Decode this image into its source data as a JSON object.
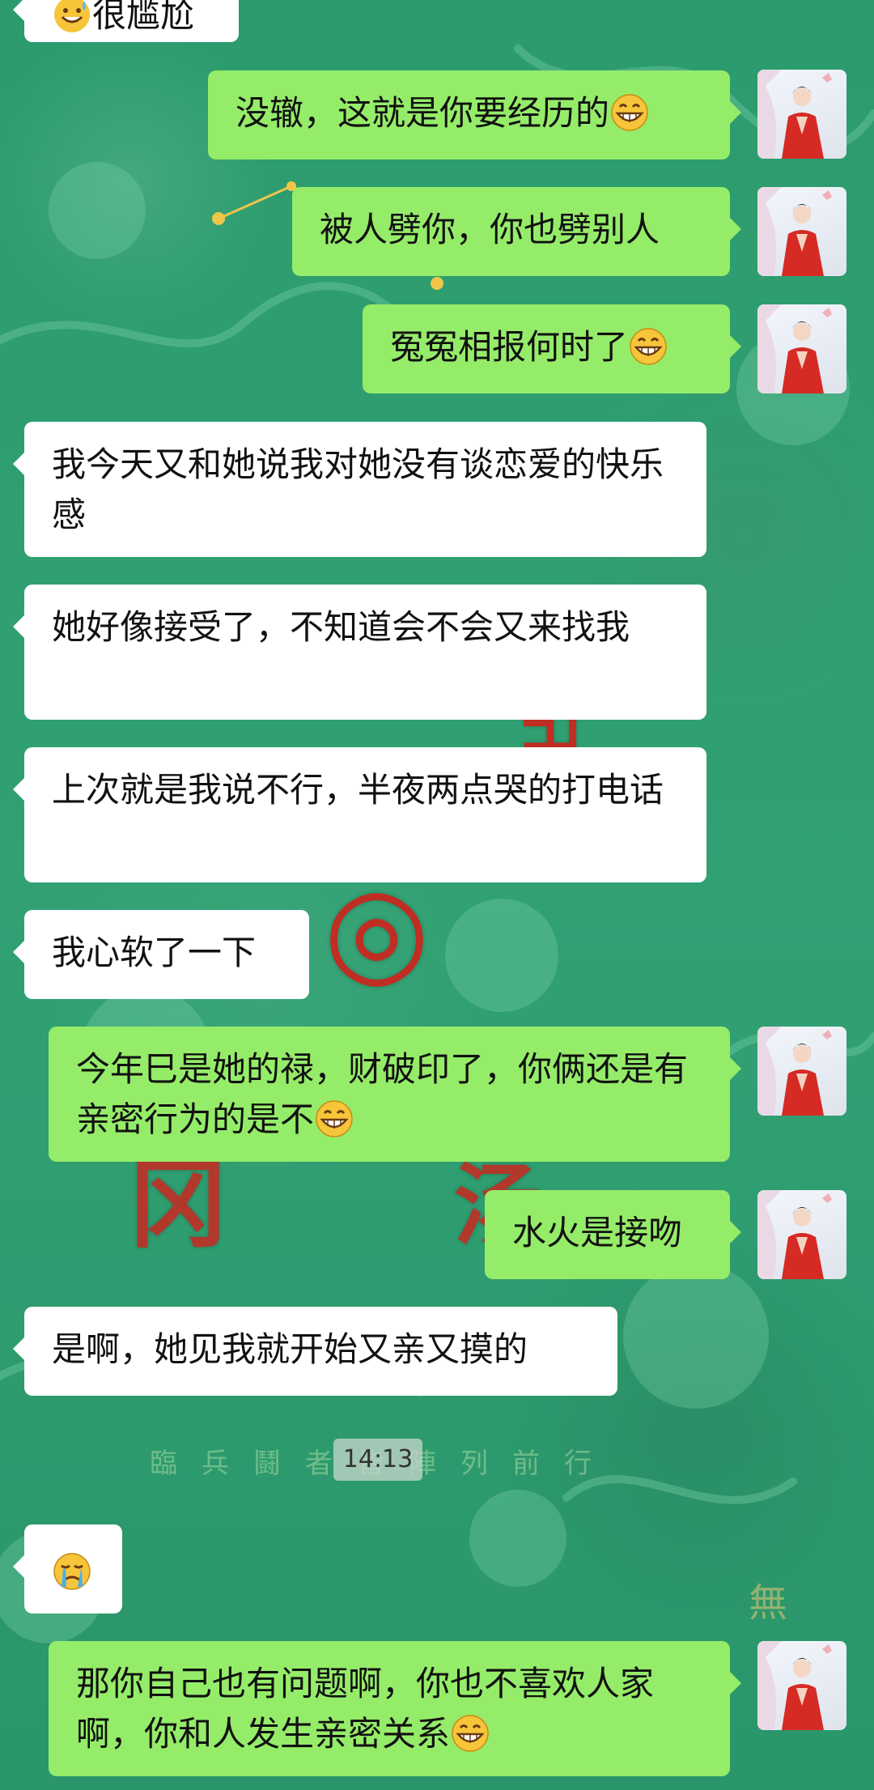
{
  "messages": [
    {
      "side": "in",
      "text": "很尴尬",
      "emoji": "sweat-laugh"
    },
    {
      "side": "out",
      "text": "没辙，这就是你要经历的",
      "emoji": "grin"
    },
    {
      "side": "out",
      "text": "被人劈你，你也劈别人",
      "emoji": ""
    },
    {
      "side": "out",
      "text": "冤冤相报何时了",
      "emoji": "grin"
    },
    {
      "side": "in",
      "text": "我今天又和她说我对她没有谈恋爱的快乐感",
      "emoji": ""
    },
    {
      "side": "in",
      "text": "她好像接受了，不知道会不会又来找我",
      "emoji": ""
    },
    {
      "side": "in",
      "text": "上次就是我说不行，半夜两点哭的打电话",
      "emoji": ""
    },
    {
      "side": "in",
      "text": "我心软了一下",
      "emoji": ""
    },
    {
      "side": "out",
      "text": "今年巳是她的禄，财破印了，你俩还是有亲密行为的是不",
      "emoji": "grin"
    },
    {
      "side": "out",
      "text": "水火是接吻",
      "emoji": ""
    },
    {
      "side": "in",
      "text": "是啊，她见我就开始又亲又摸的",
      "emoji": ""
    },
    {
      "side": "in",
      "text": "",
      "emoji": "crying"
    },
    {
      "side": "out",
      "text": "那你自己也有问题啊，你也不喜欢人家啊，你和人发生亲密关系",
      "emoji": "grin"
    }
  ],
  "timestamp": "14:13",
  "background": {
    "base_color": "#2f9d70",
    "stamp_text": "臨兵鬪者皆陣列前行",
    "corner_text": "無"
  },
  "colors": {
    "incoming_bubble": "#ffffff",
    "outgoing_bubble": "#95ec69",
    "text": "#111111"
  }
}
